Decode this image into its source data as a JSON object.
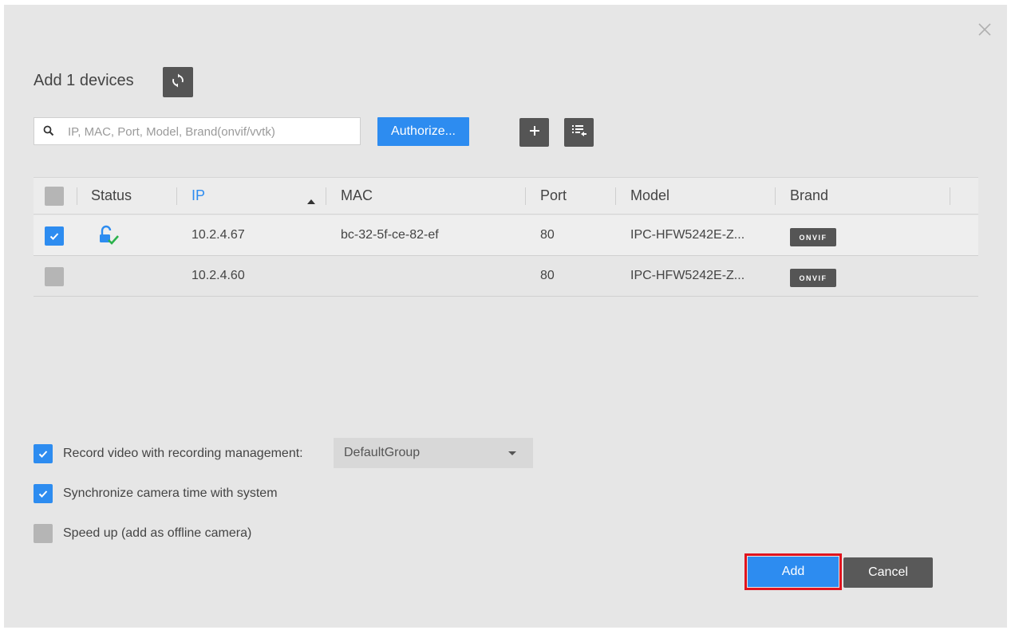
{
  "dialog": {
    "title": "Add 1 devices",
    "search_placeholder": "IP, MAC, Port, Model, Brand(onvif/vvtk)",
    "authorize_label": "Authorize...",
    "icons": [
      "refresh-icon",
      "search-icon",
      "add-icon",
      "list-import-icon",
      "close-icon"
    ]
  },
  "table": {
    "headers": {
      "status": "Status",
      "ip": "IP",
      "mac": "MAC",
      "port": "Port",
      "model": "Model",
      "brand": "Brand"
    },
    "sort_column": "IP",
    "sort_direction": "ascending",
    "rows": [
      {
        "checked": true,
        "status_icon": "unlocked-authorized-icon",
        "ip": "10.2.4.67",
        "mac": "bc-32-5f-ce-82-ef",
        "port": "80",
        "model": "IPC-HFW5242E-Z...",
        "brand": "ONVIF"
      },
      {
        "checked": false,
        "status_icon": "",
        "ip": "10.2.4.60",
        "mac": "",
        "port": "80",
        "model": "IPC-HFW5242E-Z...",
        "brand": "ONVIF"
      }
    ]
  },
  "options": {
    "record_label": "Record video with recording management:",
    "record_checked": true,
    "record_group": "DefaultGroup",
    "sync_label": "Synchronize camera time with system",
    "sync_checked": true,
    "speedup_label": "Speed up (add as offline camera)",
    "speedup_checked": false
  },
  "footer": {
    "add_label": "Add",
    "cancel_label": "Cancel"
  },
  "colors": {
    "accent": "#2d8cf0",
    "dark_button": "#555555",
    "highlight_outline": "#e0141e",
    "status_check": "#2bb24c"
  }
}
